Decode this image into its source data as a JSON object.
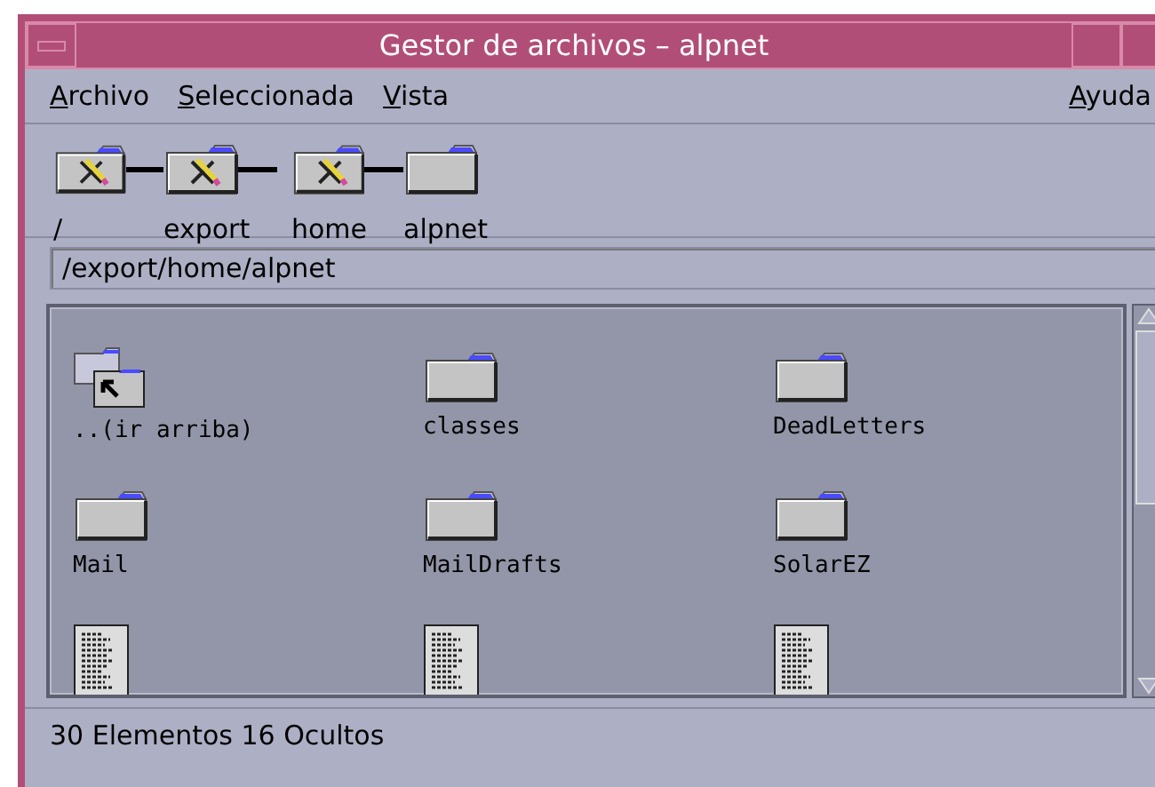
{
  "window": {
    "title": "Gestor de archivos – alpnet"
  },
  "menu": {
    "left": [
      "Archivo",
      "Seleccionada",
      "Vista"
    ],
    "right": [
      "Ayuda"
    ]
  },
  "breadcrumb": [
    {
      "label": "/",
      "kind": "restricted"
    },
    {
      "label": "export",
      "kind": "restricted"
    },
    {
      "label": "home",
      "kind": "restricted"
    },
    {
      "label": "alpnet",
      "kind": "folder"
    }
  ],
  "path_field": {
    "value": "/export/home/alpnet"
  },
  "files": [
    {
      "name": "..(ir arriba)",
      "kind": "parent"
    },
    {
      "name": "classes",
      "kind": "folder"
    },
    {
      "name": "DeadLetters",
      "kind": "folder"
    },
    {
      "name": "Mail",
      "kind": "folder"
    },
    {
      "name": "MailDrafts",
      "kind": "folder"
    },
    {
      "name": "SolarEZ",
      "kind": "folder"
    },
    {
      "kind": "document"
    },
    {
      "kind": "document"
    },
    {
      "kind": "document"
    }
  ],
  "status_bar": "30 Elementos 16 Ocultos"
}
